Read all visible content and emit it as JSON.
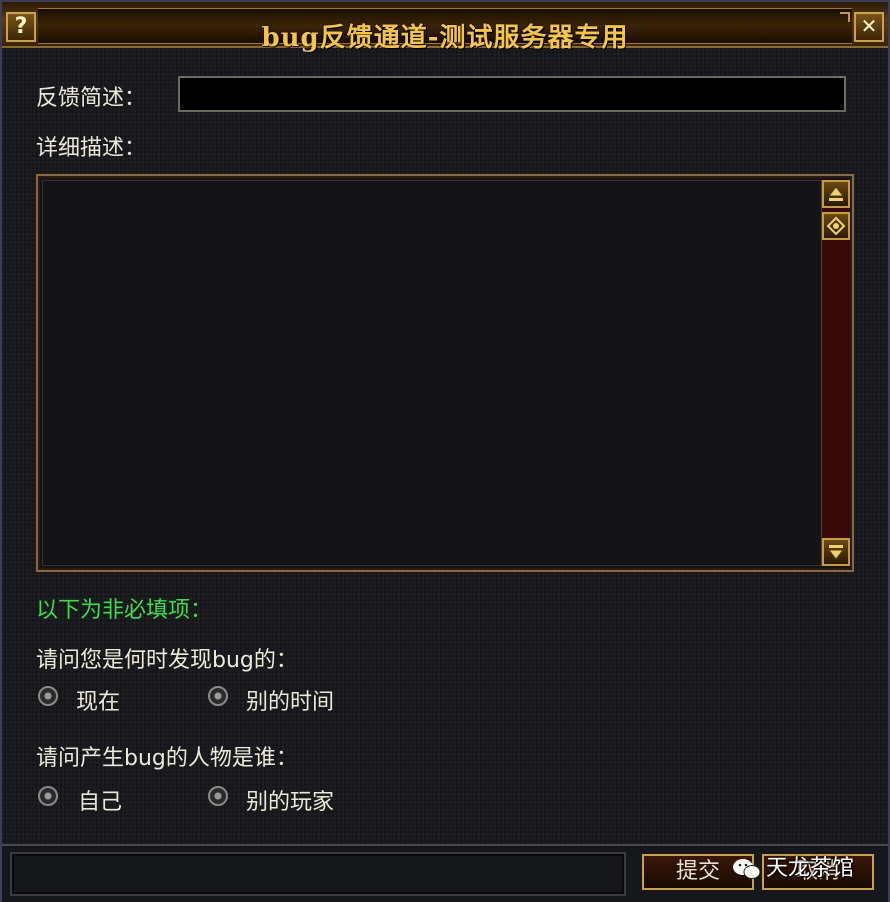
{
  "window": {
    "title": "bug反馈通道-测试服务器专用",
    "help_glyph": "?",
    "close_glyph": "✕"
  },
  "form": {
    "summary_label": "反馈简述：",
    "summary_value": "",
    "detail_label": "详细描述：",
    "detail_value": "",
    "optional_note": "以下为非必填项：",
    "question_when": "请问您是何时发现bug的：",
    "when_options": [
      "现在",
      "别的时间"
    ],
    "question_who": "请问产生bug的人物是谁：",
    "who_options": [
      "自己",
      "别的玩家"
    ]
  },
  "buttons": {
    "submit_label": "提交",
    "cancel_label": "取消"
  },
  "watermark": {
    "text": "天龙茶馆"
  },
  "colors": {
    "title_gold": "#f6c44a",
    "optional_green": "#3ddc4a",
    "frame_gold": "#c8a050"
  }
}
